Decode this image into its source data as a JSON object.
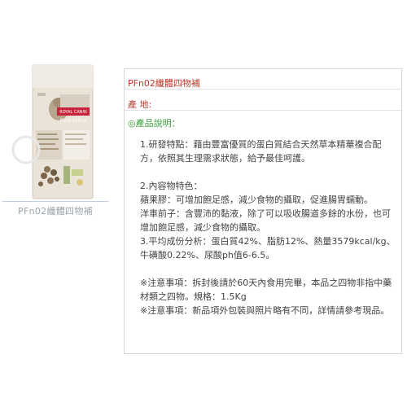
{
  "product": {
    "caption": "PFn02纖體四物補",
    "title": "PFn02纖體四物補",
    "image": {
      "brand": "ROYAL CANIN",
      "line": "Pure Feline"
    },
    "origin_label": "產 地:",
    "description_heading": "◎產品說明：",
    "description": [
      "1.研發特點：藉由豐富優質的蛋白質結合天然草本精華複合配方，依照其生理需求狀態，給予最佳呵護。",
      "",
      "2.內容物特色：",
      "蘋果膠：可增加飽足感，減少食物的攝取，促進腸胃蠕動。",
      "洋車前子：含豐沛的黏液，除了可以吸收腸道多餘的水份，也可增加飽足感，減少食物的攝取。",
      "3.平均成份分析：蛋白質42%、脂肪12%、熱量3579kcal/kg、牛磺酸0.22%、尿酸ph值6-6.5。",
      "",
      "※注意事項：拆封後請於60天內食用完畢，本品之四物非指中藥材類之四物。規格：1.5Kg",
      "※注意事項：新品項外包裝與照片略有不同，詳情請參考現品。"
    ]
  }
}
